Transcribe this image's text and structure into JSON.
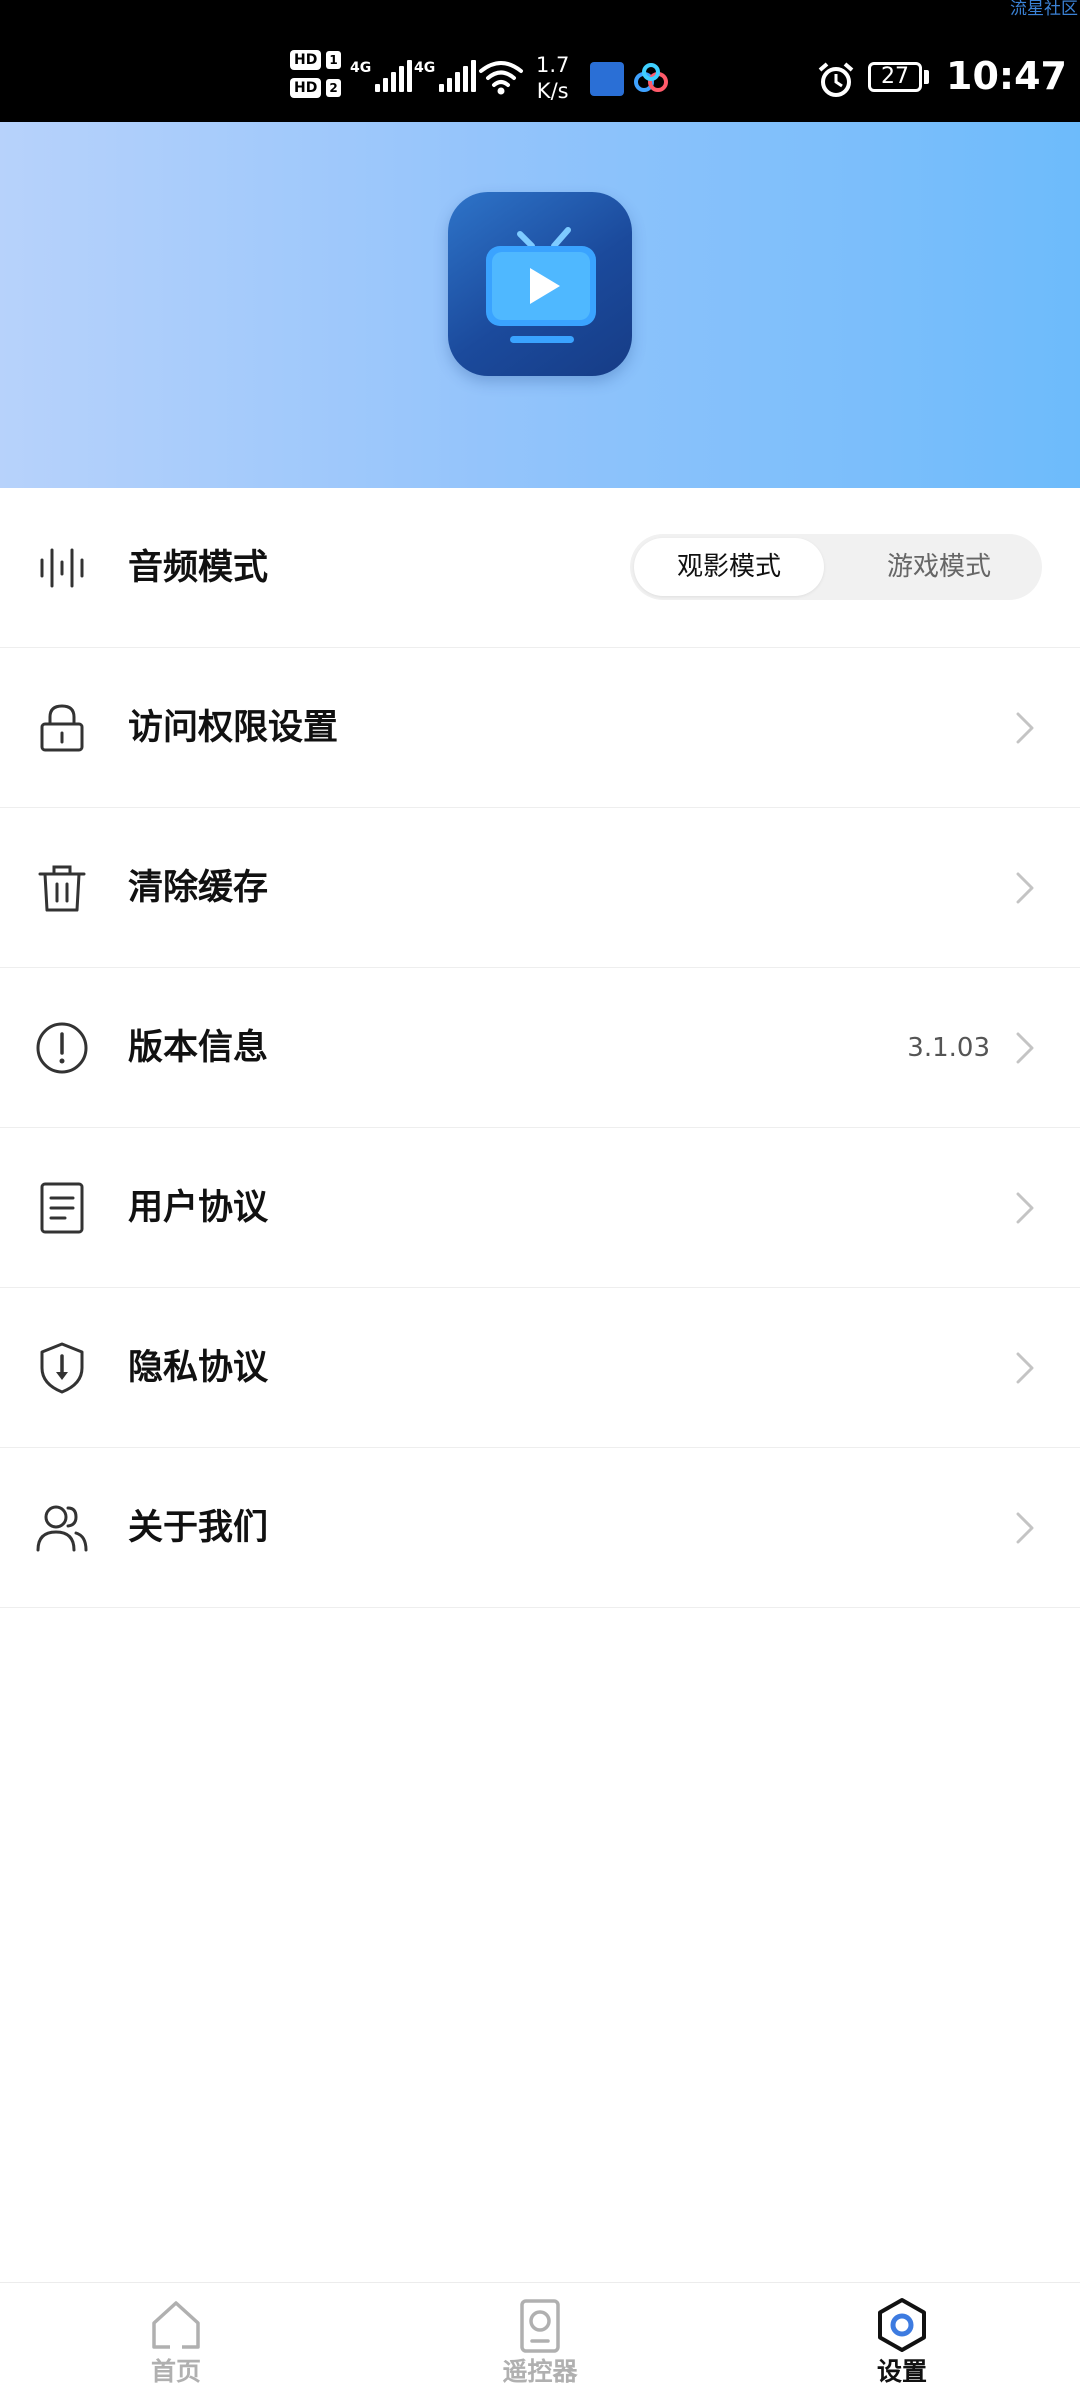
{
  "status_bar": {
    "watermark": "流星社区",
    "hd1": "HD",
    "hd1_num": "1",
    "hd2": "HD",
    "hd2_num": "2",
    "net1": "4G",
    "net2": "4G",
    "speed_value": "1.7",
    "speed_unit": "K/s",
    "battery": "27",
    "time": "10:47"
  },
  "settings": {
    "audio_mode": {
      "label": "音频模式",
      "options": [
        "观影模式",
        "游戏模式"
      ],
      "selected": "观影模式"
    },
    "items": [
      {
        "label": "访问权限设置",
        "icon": "lock-icon"
      },
      {
        "label": "清除缓存",
        "icon": "trash-icon"
      },
      {
        "label": "版本信息",
        "icon": "info-icon",
        "value": "3.1.03"
      },
      {
        "label": "用户协议",
        "icon": "document-icon"
      },
      {
        "label": "隐私协议",
        "icon": "shield-icon"
      },
      {
        "label": "关于我们",
        "icon": "users-icon"
      }
    ]
  },
  "bottom_nav": {
    "items": [
      {
        "label": "首页",
        "icon": "home-icon",
        "active": false
      },
      {
        "label": "遥控器",
        "icon": "remote-icon",
        "active": false
      },
      {
        "label": "设置",
        "icon": "settings-icon",
        "active": true
      }
    ]
  },
  "colors": {
    "banner_start": "#b7d2fb",
    "banner_end": "#6dbbfb",
    "accent_blue": "#3d7be0",
    "inactive_nav": "#b0b0b0"
  }
}
